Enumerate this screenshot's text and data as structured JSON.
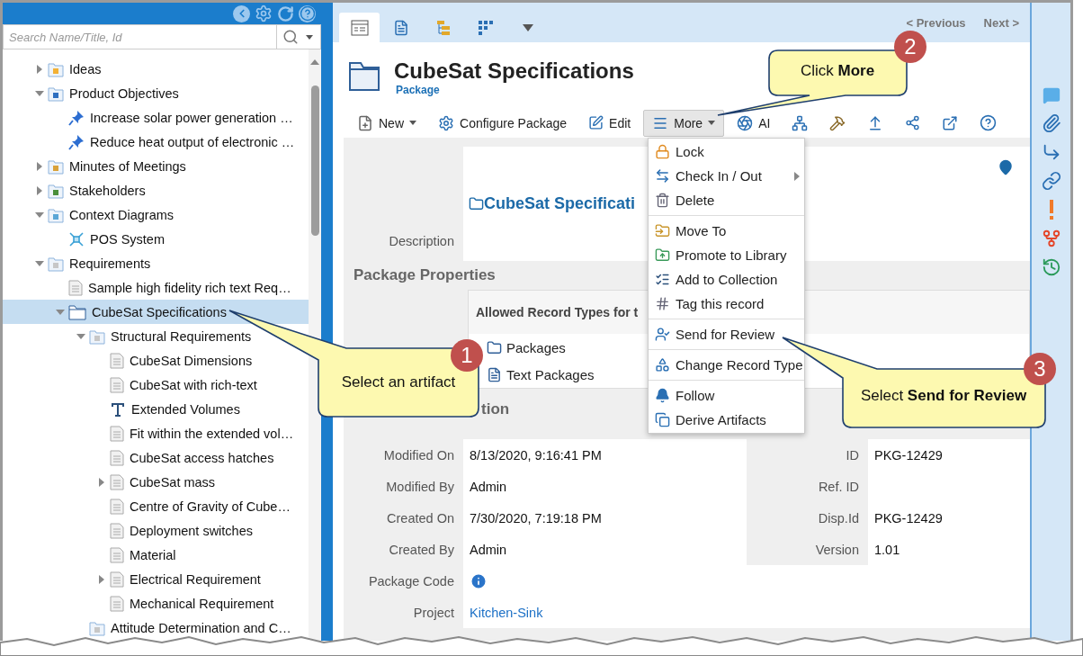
{
  "left_panel": {
    "search": {
      "placeholder": "Search Name/Title, Id"
    },
    "tree": [
      {
        "label": "Ideas",
        "kind": "idea-folder",
        "expanded": false,
        "selected": false
      },
      {
        "label": "Product Objectives",
        "kind": "objective-folder",
        "expanded": true,
        "selected": false,
        "children": [
          {
            "label": "Increase solar power generation …",
            "kind": "pin",
            "selected": false
          },
          {
            "label": "Reduce heat output of electronic …",
            "kind": "pin",
            "selected": false
          }
        ]
      },
      {
        "label": "Minutes of Meetings",
        "kind": "meeting-folder",
        "expanded": false,
        "selected": false
      },
      {
        "label": "Stakeholders",
        "kind": "stakeholder-folder",
        "expanded": false,
        "selected": false
      },
      {
        "label": "Context Diagrams",
        "kind": "diagram-folder",
        "expanded": true,
        "selected": false,
        "children": [
          {
            "label": "POS System",
            "kind": "diagram",
            "selected": false
          }
        ]
      },
      {
        "label": "Requirements",
        "kind": "requirement-folder",
        "expanded": true,
        "selected": false,
        "children": [
          {
            "label": "Sample high fidelity rich text Req…",
            "kind": "document",
            "selected": false
          },
          {
            "label": "CubeSat Specifications",
            "kind": "package",
            "expanded": true,
            "selected": true,
            "children": [
              {
                "label": "Structural Requirements",
                "kind": "requirement-folder",
                "expanded": true,
                "selected": false,
                "children": [
                  {
                    "label": "CubeSat Dimensions",
                    "kind": "document",
                    "selected": false
                  },
                  {
                    "label": "CubeSat with rich-text",
                    "kind": "document",
                    "selected": false
                  },
                  {
                    "label": "Extended Volumes",
                    "kind": "text",
                    "selected": false
                  },
                  {
                    "label": "Fit within the extended vol…",
                    "kind": "document",
                    "selected": false
                  },
                  {
                    "label": "CubeSat access hatches",
                    "kind": "document",
                    "selected": false
                  },
                  {
                    "label": "CubeSat mass",
                    "kind": "document",
                    "expanded": false,
                    "selected": false
                  },
                  {
                    "label": "Centre of Gravity of Cube…",
                    "kind": "document",
                    "selected": false
                  },
                  {
                    "label": "Deployment switches",
                    "kind": "document",
                    "selected": false
                  },
                  {
                    "label": "Material",
                    "kind": "document",
                    "selected": false
                  },
                  {
                    "label": "Electrical Requirement",
                    "kind": "document",
                    "expanded": false,
                    "selected": false
                  },
                  {
                    "label": "Mechanical Requirement",
                    "kind": "document",
                    "selected": false
                  }
                ]
              },
              {
                "label": "Attitude Determination and C…",
                "kind": "requirement-folder",
                "selected": false
              }
            ]
          }
        ]
      }
    ]
  },
  "tabs": [
    {
      "kind": "details",
      "selected": true
    },
    {
      "kind": "document",
      "selected": false
    },
    {
      "kind": "hierarchy",
      "selected": false
    },
    {
      "kind": "grid",
      "selected": false
    },
    {
      "kind": "more",
      "selected": false
    }
  ],
  "nav": {
    "previous": "< Previous",
    "next": "Next >"
  },
  "header": {
    "title": "CubeSat Specifications",
    "type": "Package"
  },
  "toolbar": [
    {
      "kind": "new",
      "label": "New",
      "dropdown": true,
      "open": false
    },
    {
      "kind": "configure",
      "label": "Configure Package",
      "dropdown": false,
      "open": false
    },
    {
      "kind": "edit",
      "label": "Edit",
      "dropdown": false,
      "open": false
    },
    {
      "kind": "more",
      "label": "More",
      "dropdown": true,
      "open": true
    },
    {
      "kind": "ai",
      "label": "AI",
      "dropdown": false,
      "open": false
    },
    {
      "kind": "network",
      "dropdown": false,
      "open": false
    },
    {
      "kind": "tools",
      "dropdown": false,
      "open": false
    },
    {
      "kind": "upload",
      "dropdown": false,
      "open": false
    },
    {
      "kind": "share",
      "dropdown": false,
      "open": false
    },
    {
      "kind": "external",
      "dropdown": false,
      "open": false
    },
    {
      "kind": "help",
      "dropdown": false,
      "open": false
    }
  ],
  "details": {
    "description_label": "Description",
    "description_title": "CubeSat Specificati",
    "properties_heading": "Package Properties",
    "allowed_header": "Allowed Record Types for t",
    "allowed_types": [
      {
        "kind": "package",
        "label": "Packages"
      },
      {
        "kind": "text-package",
        "label": "Text Packages"
      }
    ],
    "section_heading": "tion",
    "fields": [
      {
        "label": "Modified On",
        "kind": "text",
        "value": "8/13/2020, 9:16:41 PM"
      },
      {
        "label": "Modified By",
        "kind": "text",
        "value": "Admin"
      },
      {
        "label": "Created On",
        "kind": "text",
        "value": "7/30/2020, 7:19:18 PM"
      },
      {
        "label": "Created By",
        "kind": "text",
        "value": "Admin"
      },
      {
        "label": "Package Code",
        "kind": "info"
      },
      {
        "label": "Project",
        "kind": "link",
        "value": "Kitchen-Sink"
      }
    ],
    "side_fields": [
      {
        "label": "ID",
        "value": "PKG-12429"
      },
      {
        "label": "Ref. ID"
      },
      {
        "label": "Disp.Id",
        "value": "PKG-12429"
      },
      {
        "label": "Version",
        "value": "1.01"
      }
    ]
  },
  "menu": [
    [
      {
        "kind": "lock",
        "label": "Lock",
        "submenu": false
      },
      {
        "kind": "checkin",
        "label": "Check In / Out",
        "submenu": true
      },
      {
        "kind": "delete",
        "label": "Delete",
        "submenu": false
      }
    ],
    [
      {
        "kind": "move",
        "label": "Move To",
        "submenu": false
      },
      {
        "kind": "promote",
        "label": "Promote to Library",
        "submenu": false
      },
      {
        "kind": "collection",
        "label": "Add to Collection",
        "submenu": false
      },
      {
        "kind": "tag",
        "label": "Tag this record",
        "submenu": false
      }
    ],
    [
      {
        "kind": "review",
        "label": "Send for Review",
        "submenu": false
      }
    ],
    [
      {
        "kind": "change",
        "label": "Change Record Type",
        "submenu": false
      }
    ],
    [
      {
        "kind": "follow",
        "label": "Follow",
        "submenu": false
      },
      {
        "kind": "derive",
        "label": "Derive Artifacts",
        "submenu": false
      }
    ]
  ],
  "callouts": [
    {
      "number": "1",
      "text": "Select an artifact"
    },
    {
      "number": "2",
      "text": "Click **More**"
    },
    {
      "number": "3",
      "text": "Select **Send for Review**"
    }
  ]
}
